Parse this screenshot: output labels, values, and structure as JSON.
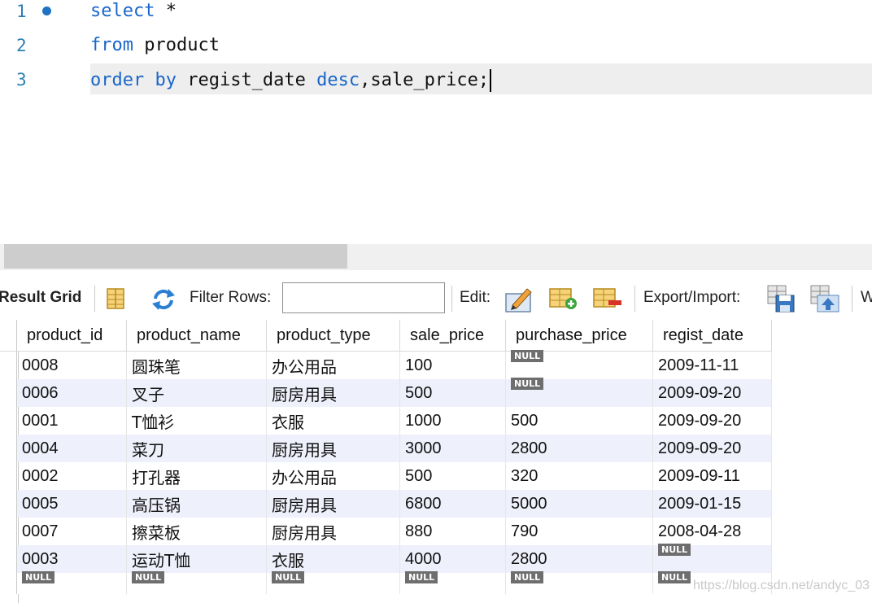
{
  "editor": {
    "lines": [
      {
        "num": "1",
        "kw1": "select",
        "rest": " *"
      },
      {
        "num": "2",
        "kw1": "from",
        "rest": " product"
      },
      {
        "num": "3",
        "kw1": "order by",
        "mid": " regist_date ",
        "kw2": "desc",
        "rest": ",sale_price;"
      }
    ]
  },
  "toolbar": {
    "result_grid": "Result Grid",
    "filter_rows": "Filter Rows:",
    "filter_value": "",
    "edit": "Edit:",
    "export_import": "Export/Import:",
    "wrap_partial": "W"
  },
  "grid": {
    "columns": [
      "product_id",
      "product_name",
      "product_type",
      "sale_price",
      "purchase_price",
      "regist_date"
    ],
    "rows": [
      [
        "0008",
        "圆珠笔",
        "办公用品",
        "100",
        "NULL",
        "2009-11-11"
      ],
      [
        "0006",
        "叉子",
        "厨房用具",
        "500",
        "NULL",
        "2009-09-20"
      ],
      [
        "0001",
        "T恤衫",
        "衣服",
        "1000",
        "500",
        "2009-09-20"
      ],
      [
        "0004",
        "菜刀",
        "厨房用具",
        "3000",
        "2800",
        "2009-09-20"
      ],
      [
        "0002",
        "打孔器",
        "办公用品",
        "500",
        "320",
        "2009-09-11"
      ],
      [
        "0005",
        "高压锅",
        "厨房用具",
        "6800",
        "5000",
        "2009-01-15"
      ],
      [
        "0007",
        "擦菜板",
        "厨房用具",
        "880",
        "790",
        "2008-04-28"
      ],
      [
        "0003",
        "运动T恤",
        "衣服",
        "4000",
        "2800",
        "NULL"
      ]
    ],
    "new_row": [
      "NULL",
      "NULL",
      "NULL",
      "NULL",
      "NULL",
      "NULL"
    ]
  },
  "watermark": "https://blog.csdn.net/andyc_03"
}
